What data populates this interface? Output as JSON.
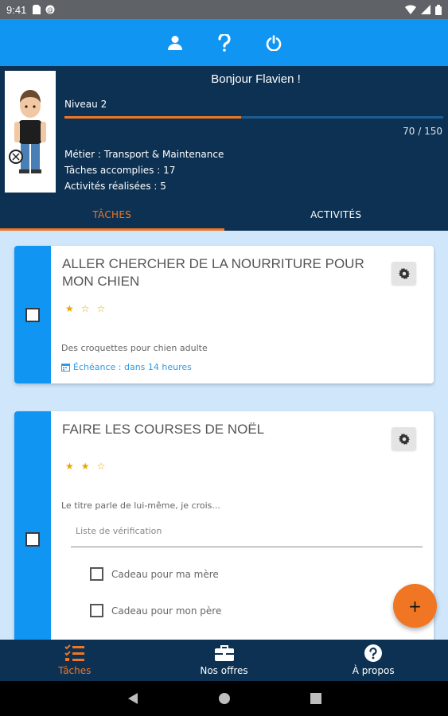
{
  "status_bar": {
    "time": "9:41"
  },
  "header": {
    "icons": [
      "user-icon",
      "help-icon",
      "power-icon"
    ]
  },
  "profile": {
    "greeting": "Bonjour Flavien !",
    "level": "Niveau 2",
    "xp": 70,
    "xp_max": 150,
    "xp_text": "70 / 150",
    "job": "Métier : Transport & Maintenance",
    "tasks_done": "Tâches accomplies : 17",
    "activities_done": "Activités réalisées : 5"
  },
  "tabs": [
    {
      "label": "TÂCHES",
      "active": true
    },
    {
      "label": "ACTIVITÉS",
      "active": false
    }
  ],
  "tasks": [
    {
      "title": "ALLER CHERCHER DE LA NOURRITURE POUR MON CHIEN",
      "stars": 1,
      "stars_max": 3,
      "description": "Des croquettes pour chien adulte",
      "due": "Échéance : dans 14 heures"
    },
    {
      "title": "FAIRE LES COURSES DE NOËL",
      "stars": 2,
      "stars_max": 3,
      "description": "Le titre parle de lui-même, je crois...",
      "checklist_placeholder": "Liste de vérification",
      "checklist": [
        {
          "label": "Cadeau pour ma mère",
          "checked": false
        },
        {
          "label": "Cadeau pour mon père",
          "checked": false
        }
      ]
    }
  ],
  "fab": {
    "label": "+"
  },
  "bottom_nav": [
    {
      "label": "Tâches",
      "icon": "tasks-icon",
      "active": true
    },
    {
      "label": "Nos offres",
      "icon": "briefcase-icon",
      "active": false
    },
    {
      "label": "À propos",
      "icon": "help-circle-icon",
      "active": false
    }
  ],
  "colors": {
    "primary": "#1195f2",
    "dark": "#0d3152",
    "accent": "#f07623",
    "background": "#cfe6fb",
    "star": "#e6a700"
  }
}
